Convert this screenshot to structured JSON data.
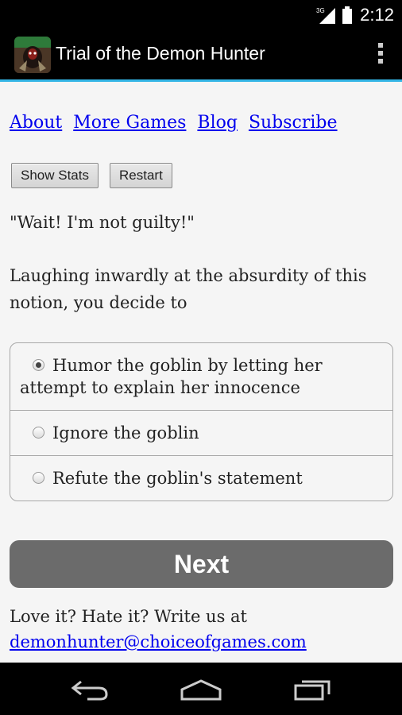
{
  "status_bar": {
    "network": "3G",
    "time": "2:12"
  },
  "app_bar": {
    "title": "Trial of the Demon Hunter",
    "app_icon": "demon-hunter-icon",
    "menu_icon": "overflow-menu-icon"
  },
  "nav_links": [
    "About",
    "More Games",
    "Blog",
    "Subscribe"
  ],
  "buttons": {
    "show_stats": "Show Stats",
    "restart": "Restart"
  },
  "story": {
    "quote": "\"Wait! I'm not guilty!\"",
    "narration": "Laughing inwardly at the absurdity of this notion, you decide to"
  },
  "choices": [
    {
      "label": "Humor the goblin by letting her attempt to explain her innocence",
      "selected": true
    },
    {
      "label": "Ignore the goblin",
      "selected": false
    },
    {
      "label": "Refute the goblin's statement",
      "selected": false
    }
  ],
  "next_label": "Next",
  "footer": {
    "prompt": "Love it? Hate it? Write us at",
    "email": "demonhunter@choiceofgames.com"
  },
  "system_nav": {
    "back_icon": "back-icon",
    "home_icon": "home-icon",
    "recents_icon": "recents-icon"
  },
  "colors": {
    "accent": "#33b5e5",
    "link": "#0000ee",
    "next_button": "#6b6b6b"
  }
}
